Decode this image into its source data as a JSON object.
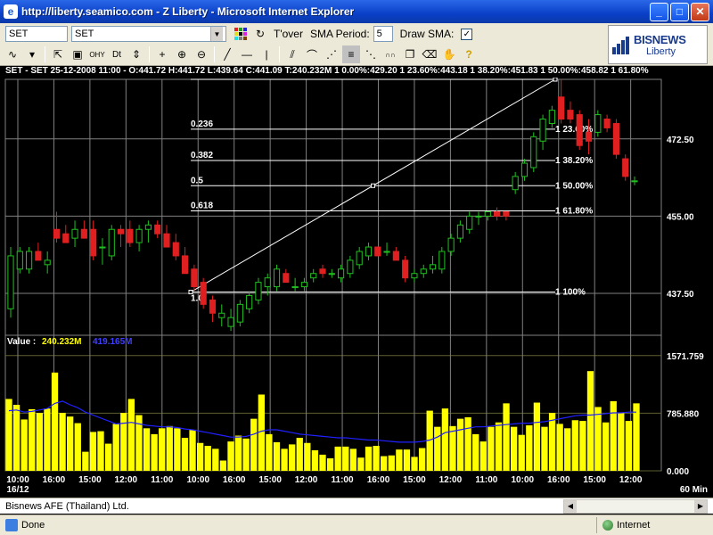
{
  "window": {
    "title": "http://liberty.seamico.com - Z Liberty - Microsoft Internet Explorer",
    "minimize": "_",
    "maximize": "□",
    "close": "✕"
  },
  "toolbar": {
    "symbol_combo": "SET",
    "symbol_select": "SET",
    "turnover_label": "T'over",
    "sma_period_label": "SMA Period:",
    "sma_period_value": "5",
    "draw_sma_label": "Draw SMA:",
    "draw_sma_checked": "✓"
  },
  "logo": {
    "brand_main": "BISNEWS",
    "brand_sub": "Liberty"
  },
  "info_line": "SET - SET 25-12-2008 11:00 - O:441.72 H:441.72 L:439.64 C:441.09 T:240.232M 1 0.00%:429.20 1 23.60%:443.18 1 38.20%:451.83 1 50.00%:458.82 1 61.80%",
  "volume_legend": {
    "label": "Value : ",
    "value1": "240.232M",
    "value2": "419.165M"
  },
  "footer": {
    "company": "Bisnews AFE (Thailand) Ltd."
  },
  "status": {
    "text": "Done",
    "zone": "Internet"
  },
  "colors": {
    "up": "#20c020",
    "down": "#e02020",
    "volume": "#ffff00",
    "sma": "#2020ff",
    "grid": "#808080",
    "fib": "#ffffff"
  },
  "chart_data": [
    {
      "type": "candlestick",
      "title": "",
      "ylim": [
        428.0,
        486.0
      ],
      "y_ticks": [
        "472.50",
        "455.00",
        "437.50"
      ],
      "x_tick_labels": [
        "10:00 16/12",
        "16:00",
        "15:00",
        "12:00",
        "11:00",
        "10:00",
        "16:00",
        "15:00",
        "12:00",
        "11:00",
        "16:00",
        "15:00",
        "12:00",
        "11:00",
        "10:00",
        "16:00",
        "15:00",
        "12:00"
      ],
      "fibonacci": [
        {
          "ratio": "0.0",
          "label": "",
          "value": 486.0
        },
        {
          "ratio": "0.236",
          "label": "1 23.60%",
          "value": 474.7
        },
        {
          "ratio": "0.382",
          "label": "1 38.20%",
          "value": 467.6
        },
        {
          "ratio": "0.5",
          "label": "1 50.00%",
          "value": 461.9
        },
        {
          "ratio": "0.618",
          "label": "1 61.80%",
          "value": 456.2
        },
        {
          "ratio": "1.0",
          "label": "1 100%",
          "value": 437.8
        }
      ],
      "candles": [
        {
          "o": 434,
          "h": 448,
          "l": 432,
          "c": 446
        },
        {
          "o": 443,
          "h": 448,
          "l": 442,
          "c": 447
        },
        {
          "o": 443,
          "h": 448,
          "l": 442,
          "c": 447
        },
        {
          "o": 447,
          "h": 449,
          "l": 445,
          "c": 445
        },
        {
          "o": 444,
          "h": 447,
          "l": 442,
          "c": 445
        },
        {
          "o": 452,
          "h": 456,
          "l": 449,
          "c": 450
        },
        {
          "o": 451,
          "h": 453,
          "l": 449,
          "c": 449
        },
        {
          "o": 450,
          "h": 454,
          "l": 448,
          "c": 452
        },
        {
          "o": 452,
          "h": 454,
          "l": 450,
          "c": 450
        },
        {
          "o": 452,
          "h": 454,
          "l": 445,
          "c": 446
        },
        {
          "o": 448,
          "h": 450,
          "l": 444,
          "c": 448
        },
        {
          "o": 446,
          "h": 453,
          "l": 445,
          "c": 452
        },
        {
          "o": 452,
          "h": 453,
          "l": 448,
          "c": 451
        },
        {
          "o": 452,
          "h": 454,
          "l": 448,
          "c": 449
        },
        {
          "o": 449,
          "h": 453,
          "l": 447,
          "c": 452
        },
        {
          "o": 452,
          "h": 454,
          "l": 449,
          "c": 453
        },
        {
          "o": 453,
          "h": 454,
          "l": 450,
          "c": 451
        },
        {
          "o": 451,
          "h": 453,
          "l": 448,
          "c": 448
        },
        {
          "o": 449,
          "h": 451,
          "l": 445,
          "c": 446
        },
        {
          "o": 446,
          "h": 448,
          "l": 442,
          "c": 442
        },
        {
          "o": 443,
          "h": 444,
          "l": 438,
          "c": 439
        },
        {
          "o": 440,
          "h": 441,
          "l": 434,
          "c": 435
        },
        {
          "o": 436,
          "h": 437,
          "l": 431,
          "c": 433
        },
        {
          "o": 432,
          "h": 435,
          "l": 430,
          "c": 433
        },
        {
          "o": 430,
          "h": 434,
          "l": 429,
          "c": 432
        },
        {
          "o": 431,
          "h": 436,
          "l": 430,
          "c": 435
        },
        {
          "o": 434,
          "h": 438,
          "l": 433,
          "c": 437
        },
        {
          "o": 436,
          "h": 441,
          "l": 435,
          "c": 440
        },
        {
          "o": 439,
          "h": 442,
          "l": 437,
          "c": 441
        },
        {
          "o": 439,
          "h": 444,
          "l": 438,
          "c": 443
        },
        {
          "o": 442,
          "h": 443,
          "l": 440,
          "c": 440
        },
        {
          "o": 439,
          "h": 441,
          "l": 438,
          "c": 439
        },
        {
          "o": 439,
          "h": 441,
          "l": 438,
          "c": 440
        },
        {
          "o": 441,
          "h": 443,
          "l": 440,
          "c": 442
        },
        {
          "o": 443,
          "h": 444,
          "l": 441,
          "c": 442
        },
        {
          "o": 442,
          "h": 443,
          "l": 441,
          "c": 442
        },
        {
          "o": 441,
          "h": 444,
          "l": 440,
          "c": 443
        },
        {
          "o": 442,
          "h": 446,
          "l": 441,
          "c": 445
        },
        {
          "o": 444,
          "h": 448,
          "l": 443,
          "c": 447
        },
        {
          "o": 446,
          "h": 449,
          "l": 445,
          "c": 448
        },
        {
          "o": 448,
          "h": 448,
          "l": 446,
          "c": 446
        },
        {
          "o": 447,
          "h": 449,
          "l": 446,
          "c": 447
        },
        {
          "o": 447,
          "h": 448,
          "l": 445,
          "c": 445
        },
        {
          "o": 445,
          "h": 446,
          "l": 440,
          "c": 441
        },
        {
          "o": 441,
          "h": 443,
          "l": 440,
          "c": 442
        },
        {
          "o": 442,
          "h": 444,
          "l": 441,
          "c": 443
        },
        {
          "o": 443,
          "h": 446,
          "l": 442,
          "c": 444
        },
        {
          "o": 443,
          "h": 448,
          "l": 442,
          "c": 447
        },
        {
          "o": 447,
          "h": 451,
          "l": 446,
          "c": 450
        },
        {
          "o": 450,
          "h": 454,
          "l": 449,
          "c": 453
        },
        {
          "o": 452,
          "h": 456,
          "l": 451,
          "c": 455
        },
        {
          "o": 455,
          "h": 456,
          "l": 453,
          "c": 455
        },
        {
          "o": 455,
          "h": 456,
          "l": 454,
          "c": 456
        },
        {
          "o": 456,
          "h": 457,
          "l": 454,
          "c": 455
        },
        {
          "o": 456,
          "h": 456,
          "l": 454,
          "c": 455
        },
        {
          "o": 461,
          "h": 465,
          "l": 460,
          "c": 464
        },
        {
          "o": 464,
          "h": 468,
          "l": 463,
          "c": 467
        },
        {
          "o": 466,
          "h": 474,
          "l": 465,
          "c": 473
        },
        {
          "o": 472,
          "h": 478,
          "l": 470,
          "c": 477
        },
        {
          "o": 476,
          "h": 480,
          "l": 475,
          "c": 479
        },
        {
          "o": 482,
          "h": 486,
          "l": 476,
          "c": 477
        },
        {
          "o": 479,
          "h": 481,
          "l": 476,
          "c": 477
        },
        {
          "o": 478,
          "h": 479,
          "l": 470,
          "c": 471
        },
        {
          "o": 474,
          "h": 477,
          "l": 469,
          "c": 472
        },
        {
          "o": 474,
          "h": 479,
          "l": 473,
          "c": 478
        },
        {
          "o": 477,
          "h": 478,
          "l": 474,
          "c": 475
        },
        {
          "o": 476,
          "h": 477,
          "l": 468,
          "c": 469
        },
        {
          "o": 468,
          "h": 469,
          "l": 463,
          "c": 464
        },
        {
          "o": 463,
          "h": 464,
          "l": 462,
          "c": 463
        }
      ]
    },
    {
      "type": "bar",
      "title": "Value",
      "ylim": [
        0,
        1800
      ],
      "y_ticks": [
        "1571.759",
        "785.880",
        "0.000"
      ],
      "x_unit_label": "60 Min",
      "series": [
        {
          "name": "240.232M",
          "type": "bar",
          "values": [
            980,
            900,
            700,
            840,
            790,
            850,
            1340,
            790,
            740,
            650,
            260,
            530,
            540,
            370,
            640,
            790,
            980,
            760,
            580,
            500,
            580,
            610,
            580,
            450,
            560,
            380,
            340,
            300,
            140,
            400,
            480,
            440,
            710,
            1040,
            500,
            390,
            300,
            360,
            450,
            380,
            280,
            220,
            170,
            330,
            330,
            300,
            180,
            330,
            340,
            200,
            210,
            290,
            290,
            190,
            310,
            820,
            600,
            850,
            610,
            710,
            730,
            500,
            400,
            600,
            660,
            920,
            600,
            490,
            620,
            930,
            600,
            790,
            640,
            580,
            690,
            680,
            1360,
            870,
            660,
            950,
            790,
            680,
            920
          ]
        },
        {
          "name": "419.165M",
          "type": "line",
          "values": [
            820,
            830,
            800,
            810,
            830,
            850,
            920,
            950,
            900,
            860,
            800,
            760,
            720,
            680,
            640,
            650,
            660,
            640,
            620,
            610,
            600,
            600,
            590,
            570,
            560,
            540,
            520,
            500,
            480,
            460,
            460,
            470,
            500,
            540,
            560,
            560,
            540,
            520,
            500,
            490,
            480,
            470,
            460,
            450,
            450,
            440,
            430,
            420,
            420,
            410,
            400,
            390,
            390,
            390,
            400,
            420,
            460,
            520,
            540,
            560,
            580,
            600,
            600,
            610,
            620,
            630,
            640,
            650,
            650,
            660,
            670,
            690,
            710,
            730,
            750,
            760,
            760,
            770,
            780,
            790,
            790,
            800,
            800
          ]
        }
      ]
    }
  ]
}
